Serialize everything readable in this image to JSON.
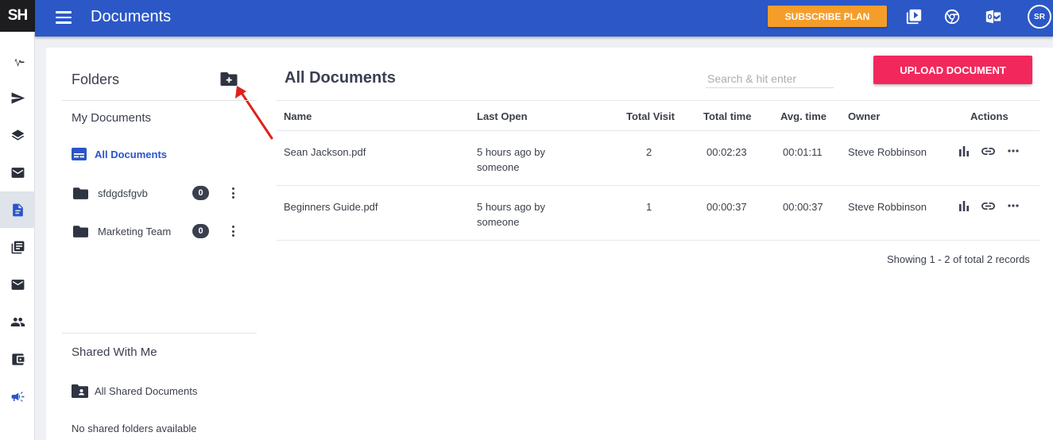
{
  "app": {
    "logo": "SH"
  },
  "rail": {
    "items": [
      {
        "icon": "pulse-icon"
      },
      {
        "icon": "send-icon"
      },
      {
        "icon": "layers-icon"
      },
      {
        "icon": "inbox-icon"
      },
      {
        "icon": "document-icon",
        "active": true
      },
      {
        "icon": "library-icon"
      },
      {
        "icon": "mail-icon"
      },
      {
        "icon": "people-icon"
      },
      {
        "icon": "wallet-icon"
      },
      {
        "icon": "megaphone-icon"
      }
    ]
  },
  "header": {
    "title": "Documents",
    "subscribe_label": "SUBSCRIBE PLAN",
    "avatar_initials": "SR",
    "icons": [
      "video-library-icon",
      "chrome-icon",
      "outlook-icon"
    ]
  },
  "folders": {
    "title": "Folders",
    "my_documents_title": "My Documents",
    "all_documents_label": "All Documents",
    "items": [
      {
        "name": "sfdgdsfgvb",
        "count": "0"
      },
      {
        "name": "Marketing Team",
        "count": "0"
      }
    ],
    "shared_title": "Shared With Me",
    "all_shared_label": "All Shared Documents",
    "no_shared_text": "No shared folders available"
  },
  "documents": {
    "title": "All Documents",
    "search_placeholder": "Search & hit enter",
    "upload_label": "UPLOAD DOCUMENT",
    "columns": [
      "Name",
      "Last Open",
      "Total Visit",
      "Total time",
      "Avg. time",
      "Owner",
      "Actions"
    ],
    "rows": [
      {
        "name": "Sean Jackson.pdf",
        "last_open": "5 hours ago by",
        "last_open_by": "someone",
        "total_visit": "2",
        "total_time": "00:02:23",
        "avg_time": "00:01:11",
        "owner": "Steve Robbinson"
      },
      {
        "name": "Beginners Guide.pdf",
        "last_open": "5 hours ago by",
        "last_open_by": "someone",
        "total_visit": "1",
        "total_time": "00:00:37",
        "avg_time": "00:00:37",
        "owner": "Steve Robbinson"
      }
    ],
    "records_text": "Showing 1 - 2 of total 2 records"
  },
  "colors": {
    "topbar": "#2b58c6",
    "subscribe": "#f59d2a",
    "upload": "#f2285c",
    "accent": "#2a55c8",
    "arrow": "#e0201a"
  }
}
